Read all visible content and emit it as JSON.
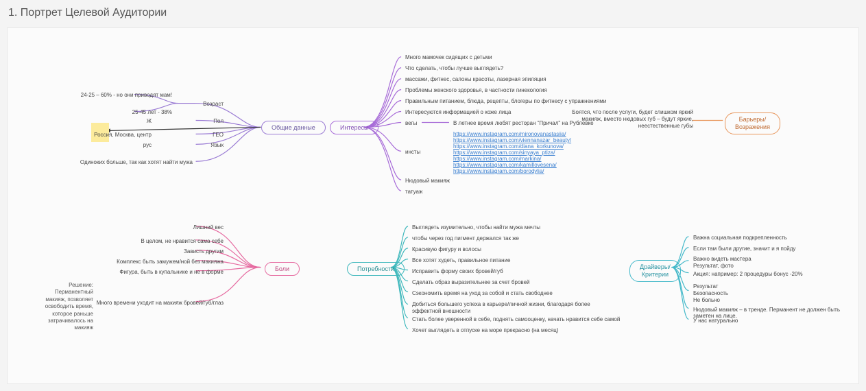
{
  "title": "1. Портрет Целевой Аудитории",
  "nodes": {
    "general": "Общие данные",
    "interests": "Интересы",
    "barriers": "Барьеры/\nВозражения",
    "pain": "Боли",
    "needs": "Потребности",
    "drivers": "Драйверы/\nКритерии"
  },
  "general": {
    "labels": [
      "Возраст",
      "Пол",
      "ГЕО",
      "Язык"
    ],
    "age": [
      "24-25 – 60% - но они приводят мам!",
      "25-45 лет - 38%"
    ],
    "items": [
      "",
      "Ж",
      "Россия, Москва, центр",
      "рус",
      "Одиноких больше, так как хотят найти мужа"
    ]
  },
  "interests": {
    "items": [
      "Много мамочек сидящих с детьми",
      "Что сделать, чтобы лучше выглядеть?",
      "массажи, фитнес, салоны красоты, лазерная эпиляция",
      "Проблемы женского здоровья, в частности гинекология",
      "Правильным питанием, блюда, рецепты, блогеры по фитнесу с упражнениями",
      "Интересуются информацией о коже лица",
      "вегы",
      "инсты",
      "Нюдовый макияж",
      "татуаж"
    ],
    "items_sub": [
      "В летнее время любят ресторан \"Причал\" на Рублевке"
    ],
    "links": [
      "https://www.instagram.com/mironovanastasiia/",
      "https://www.instagram.com/viennanazar_beauty/",
      "https://www.instagram.com/diana_korkunova/",
      "https://www.instagram.com/sinyaya_ptiza/",
      "https://www.instagram.com/markina/",
      "https://www.instagram.com/kamillovesena/",
      "https://www.instagram.com/borodylia/"
    ]
  },
  "barriers": {
    "items": [
      "Боятся, что после услуги, будет слишком яркий макияж, вместо нюдовых губ – будут яркие, неестественные губы"
    ]
  },
  "pain": {
    "items": [
      "Лишний вес",
      "В целом, не нравится сама себе",
      "Зависть другим",
      "Комплекс быть замужем/ной без макияжа",
      "Фигура, быть в купальнике и не в форме",
      "Много времени уходит на макияж бровей/губ/глаз"
    ],
    "solution": "Решение: Перманентный макияж, позволяет освободить время, которое раньше затрачивалось на макияж"
  },
  "needs": {
    "items": [
      "Выглядеть изумительно, чтобы найти мужа мечты",
      "чтобы через год пигмент держался так же",
      "Красивую фигуру и волосы",
      "Все хотят худеть, правильное питание",
      "Исправить форму своих бровей/губ",
      "Сделать образ выразительнее за счет бровей",
      "Сэкономить время на уход за собой и стать свободнее",
      "Добиться большего успеха в карьере/личной жизни, благодаря более эффектной внешности",
      "Стать более уверенной в себе, поднять самооценку, начать нравится себе самой",
      "Хочет выглядеть в отпуске на море прекрасно (на месяц)"
    ]
  },
  "drivers": {
    "items": [
      "Важна социальная подкрепленность",
      "Если там были другие, значит и я пойду",
      "Важно видеть мастера\nРезультат, фото",
      "Акция: например: 2 процедуры бонус -20%",
      "Результат\nБезопасность\nНе больно",
      "Нюдовый макияж – в тренде. Перманент не должен быть заметен на лице.",
      "У нас натурально"
    ]
  }
}
